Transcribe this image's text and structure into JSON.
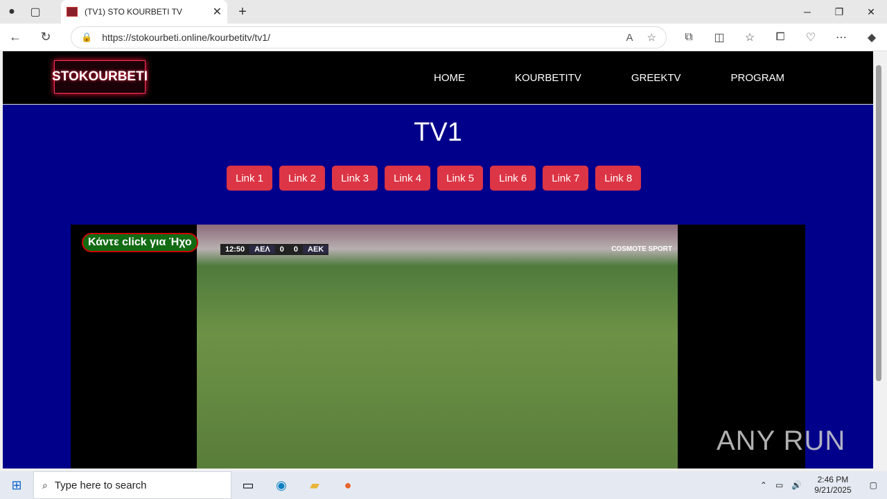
{
  "browser": {
    "tab_title": "(TV1) STO KOURBETI TV",
    "url": "https://stokourbeti.online/kourbetitv/tv1/"
  },
  "site": {
    "logo": "STOKOURBETI",
    "menu": [
      "HOME",
      "KOURBETITV",
      "GREEKTV",
      "PROGRAM"
    ],
    "title": "TV1",
    "links": [
      "Link 1",
      "Link 2",
      "Link 3",
      "Link 4",
      "Link 5",
      "Link 6",
      "Link 7",
      "Link 8"
    ]
  },
  "player": {
    "sound_button": "Κάντε click για Ήχο",
    "clock": "12:50",
    "home_team": "ΑΕΛ",
    "home_score": "0",
    "away_score": "0",
    "away_team": "ΑΕΚ",
    "broadcaster": "COSMOTE SPORT"
  },
  "watermark": "ANY RUN",
  "taskbar": {
    "search_placeholder": "Type here to search",
    "time": "2:46 PM",
    "date": "9/21/2025"
  }
}
